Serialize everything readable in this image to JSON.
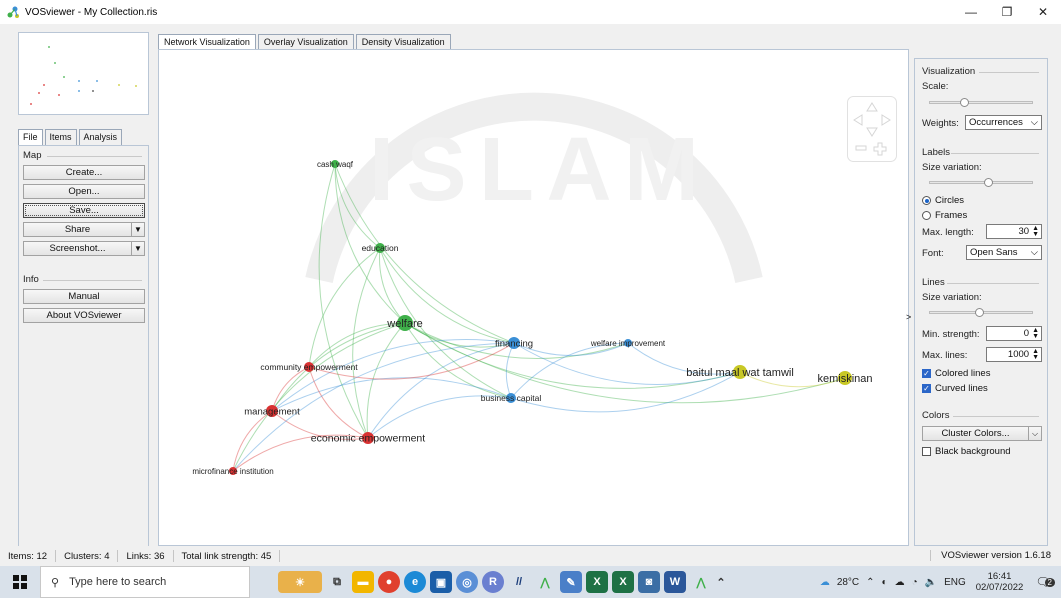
{
  "window": {
    "title": "VOSviewer - My Collection.ris",
    "minimize": "—",
    "maximize": "❐",
    "close": "✕"
  },
  "left": {
    "tabs": [
      "File",
      "Items",
      "Analysis"
    ],
    "map_group": "Map",
    "buttons": {
      "create": "Create...",
      "open": "Open...",
      "save": "Save...",
      "share": "Share",
      "screenshot": "Screenshot..."
    },
    "info_group": "Info",
    "info_buttons": {
      "manual": "Manual",
      "about": "About VOSviewer"
    }
  },
  "main_tabs": [
    "Network Visualization",
    "Overlay Visualization",
    "Density Visualization"
  ],
  "network": {
    "nodes": [
      {
        "label": "cash waqf",
        "color": "#3fb04a"
      },
      {
        "label": "education",
        "color": "#3fb04a"
      },
      {
        "label": "welfare",
        "color": "#3fb04a"
      },
      {
        "label": "financing",
        "color": "#3a8fd6"
      },
      {
        "label": "welfare improvement",
        "color": "#3a8fd6"
      },
      {
        "label": "business capital",
        "color": "#3a8fd6"
      },
      {
        "label": "baitul maal wat tamwil",
        "color": "#c8c825"
      },
      {
        "label": "kemiskinan",
        "color": "#c8c825"
      },
      {
        "label": "community empowerment",
        "color": "#d93232"
      },
      {
        "label": "management",
        "color": "#d93232"
      },
      {
        "label": "economic empowerment",
        "color": "#d93232"
      },
      {
        "label": "microfinance institution",
        "color": "#d93232"
      }
    ]
  },
  "right": {
    "visualization": "Visualization",
    "scale": "Scale:",
    "weights_label": "Weights:",
    "weights_value": "Occurrences",
    "labels": "Labels",
    "size_variation": "Size variation:",
    "circles": "Circles",
    "frames": "Frames",
    "max_length_label": "Max. length:",
    "max_length_value": "30",
    "font_label": "Font:",
    "font_value": "Open Sans",
    "lines": "Lines",
    "lines_size_variation": "Size variation:",
    "min_strength_label": "Min. strength:",
    "min_strength_value": "0",
    "max_lines_label": "Max. lines:",
    "max_lines_value": "1000",
    "colored_lines": "Colored lines",
    "curved_lines": "Curved lines",
    "colors": "Colors",
    "cluster_colors": "Cluster Colors...",
    "black_background": "Black background"
  },
  "status": {
    "items": "Items:  12",
    "clusters": "Clusters:  4",
    "links": "Links:  36",
    "strength": "Total link strength:  45",
    "version": "VOSviewer version 1.6.18"
  },
  "taskbar": {
    "search_placeholder": "Type here to search",
    "weather": "28°C",
    "lang": "ENG",
    "time": "16:41",
    "date": "02/07/2022",
    "notifications": "2"
  }
}
